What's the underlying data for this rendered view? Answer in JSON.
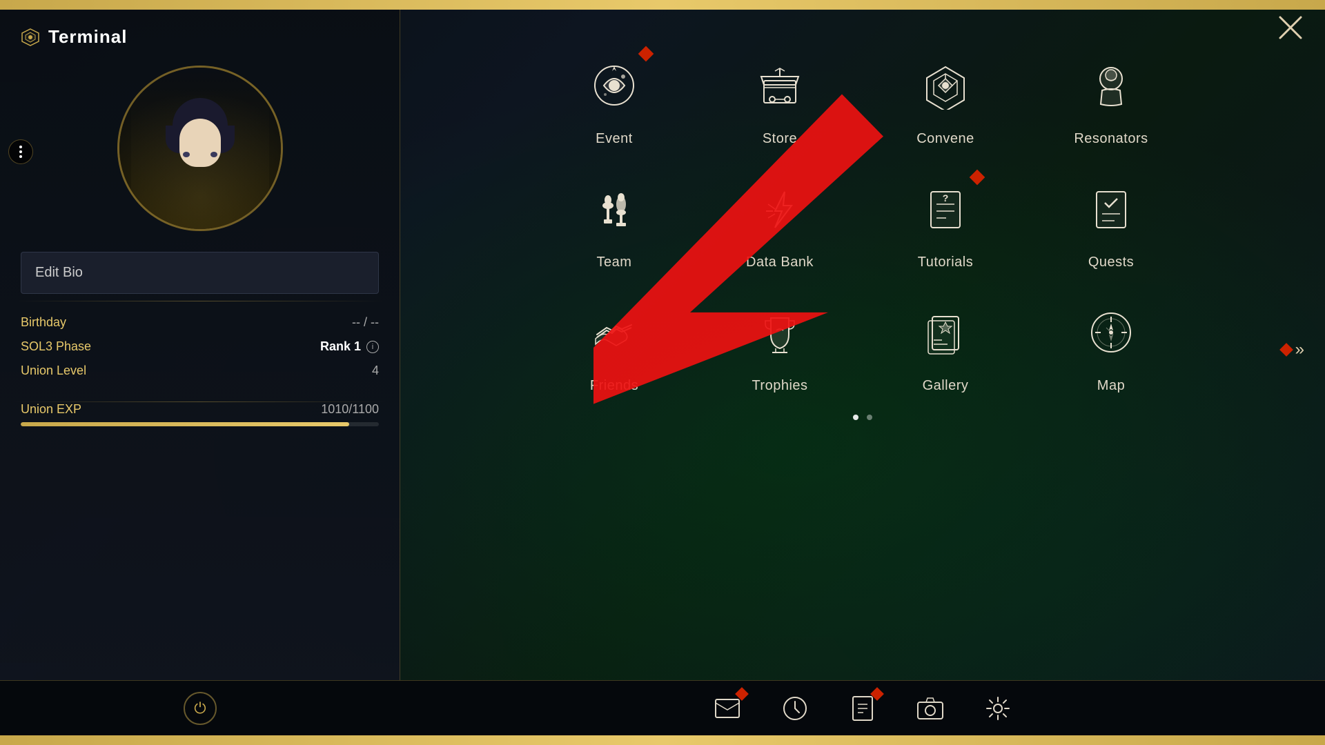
{
  "app": {
    "title": "Terminal",
    "close_label": "✕"
  },
  "player": {
    "edit_bio_label": "Edit Bio",
    "birthday_label": "Birthday",
    "birthday_value": "-- / --",
    "sol3_label": "SOL3 Phase",
    "sol3_value": "Rank 1",
    "union_level_label": "Union Level",
    "union_level_value": "4",
    "union_exp_label": "Union EXP",
    "union_exp_value": "1010/1100",
    "exp_percent": 91.8
  },
  "menu": {
    "items": [
      {
        "id": "event",
        "label": "Event",
        "icon": "event",
        "has_notification": true
      },
      {
        "id": "store",
        "label": "Store",
        "icon": "store",
        "has_notification": false
      },
      {
        "id": "convene",
        "label": "Convene",
        "icon": "convene",
        "has_notification": false
      },
      {
        "id": "resonators",
        "label": "Resonators",
        "icon": "resonators",
        "has_notification": false
      },
      {
        "id": "team",
        "label": "Team",
        "icon": "team",
        "has_notification": false
      },
      {
        "id": "databank",
        "label": "Data Bank",
        "icon": "databank",
        "has_notification": false
      },
      {
        "id": "tutorials",
        "label": "Tutorials",
        "icon": "tutorials",
        "has_notification": true
      },
      {
        "id": "quests",
        "label": "Quests",
        "icon": "quests",
        "has_notification": false
      },
      {
        "id": "friends",
        "label": "Friends",
        "icon": "friends",
        "has_notification": false
      },
      {
        "id": "trophies",
        "label": "Trophies",
        "icon": "trophies",
        "has_notification": false
      },
      {
        "id": "gallery",
        "label": "Gallery",
        "icon": "gallery",
        "has_notification": false
      },
      {
        "id": "map",
        "label": "Map",
        "icon": "map",
        "has_notification": false
      }
    ]
  },
  "page_dots": [
    {
      "active": true
    },
    {
      "active": false
    }
  ],
  "taskbar": {
    "power_icon": "⏻",
    "icons": [
      {
        "id": "mail",
        "has_notification": true
      },
      {
        "id": "clock",
        "has_notification": false
      },
      {
        "id": "document",
        "has_notification": true
      },
      {
        "id": "camera",
        "has_notification": false
      },
      {
        "id": "settings",
        "has_notification": false
      }
    ]
  },
  "colors": {
    "gold": "#c8a84b",
    "notification_red": "#cc2200",
    "text_primary": "#e0d8c8",
    "text_gold": "#e8c96a"
  }
}
